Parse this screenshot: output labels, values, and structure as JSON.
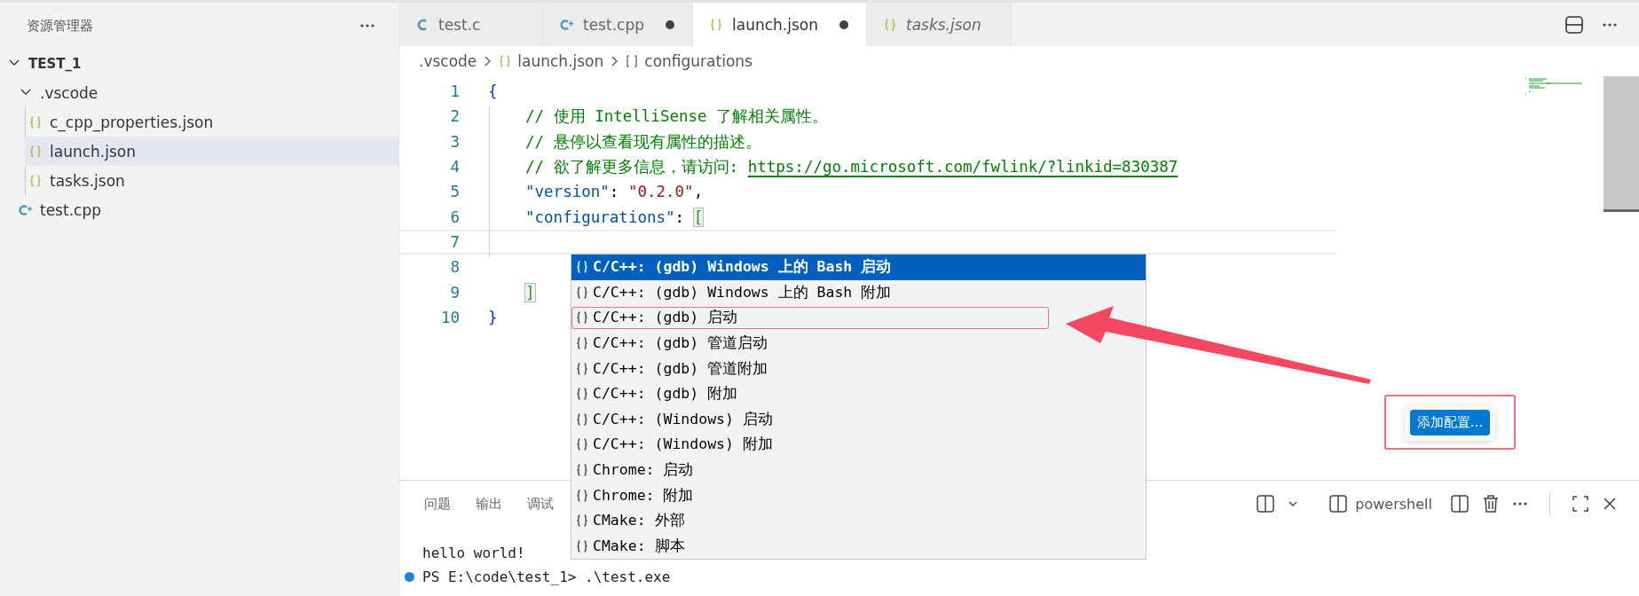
{
  "sidebar": {
    "title": "资源管理器",
    "tree": [
      {
        "label": "TEST_1",
        "kind": "root",
        "expanded": true,
        "selected": false,
        "children": [
          {
            "label": ".vscode",
            "kind": "folder",
            "expanded": true,
            "selected": false,
            "children": [
              {
                "label": "c_cpp_properties.json",
                "kind": "json",
                "selected": false
              },
              {
                "label": "launch.json",
                "kind": "json",
                "selected": true
              },
              {
                "label": "tasks.json",
                "kind": "json",
                "selected": false
              }
            ]
          },
          {
            "label": "test.cpp",
            "kind": "cpp",
            "selected": false
          }
        ]
      }
    ]
  },
  "tabs": [
    {
      "label": "test.c",
      "kind": "c",
      "selected": false,
      "modified": false,
      "preview": false
    },
    {
      "label": "test.cpp",
      "kind": "cpp",
      "selected": false,
      "modified": true,
      "preview": false
    },
    {
      "label": "launch.json",
      "kind": "json",
      "selected": true,
      "modified": true,
      "preview": false
    },
    {
      "label": "tasks.json",
      "kind": "json",
      "selected": false,
      "modified": false,
      "preview": true
    }
  ],
  "breadcrumb": [
    {
      "label": ".vscode",
      "kind": "folder"
    },
    {
      "label": "launch.json",
      "kind": "json"
    },
    {
      "label": "configurations",
      "kind": "array"
    }
  ],
  "editor": {
    "lines": [
      {
        "number": "1",
        "current": false,
        "indented": false,
        "tokens": [
          {
            "text": "{",
            "kind": "brace"
          }
        ]
      },
      {
        "number": "2",
        "current": false,
        "indented": true,
        "tokens": [
          {
            "text": "// 使用 IntelliSense 了解相关属性。",
            "kind": "comment"
          }
        ]
      },
      {
        "number": "3",
        "current": false,
        "indented": true,
        "tokens": [
          {
            "text": "// 悬停以查看现有属性的描述。",
            "kind": "comment"
          }
        ]
      },
      {
        "number": "4",
        "current": false,
        "indented": true,
        "tokens": [
          {
            "text": "// 欲了解更多信息，请访问: ",
            "kind": "comment"
          },
          {
            "text": "https://go.microsoft.com/fwlink/?linkid=830387",
            "kind": "link"
          }
        ]
      },
      {
        "number": "5",
        "current": false,
        "indented": true,
        "tokens": [
          {
            "text": "\"version\"",
            "kind": "key"
          },
          {
            "text": ": ",
            "kind": "punct"
          },
          {
            "text": "\"0.2.0\"",
            "kind": "string"
          },
          {
            "text": ",",
            "kind": "punct"
          }
        ]
      },
      {
        "number": "6",
        "current": false,
        "indented": true,
        "tokens": [
          {
            "text": "\"configurations\"",
            "kind": "key"
          },
          {
            "text": ": ",
            "kind": "punct"
          },
          {
            "text": "[",
            "kind": "bracket-match"
          }
        ]
      },
      {
        "number": "7",
        "current": true
      },
      {
        "number": "8",
        "current": false
      },
      {
        "number": "9",
        "current": false,
        "indented": true,
        "tokens": [
          {
            "text": "]",
            "kind": "bracket-match"
          }
        ]
      },
      {
        "number": "10",
        "current": false,
        "indented": false,
        "tokens": [
          {
            "text": "}",
            "kind": "brace"
          }
        ]
      }
    ]
  },
  "suggestions": [
    {
      "label": "C/C++: (gdb) Windows 上的 Bash 启动",
      "selected": true,
      "annotated": false
    },
    {
      "label": "C/C++: (gdb) Windows 上的 Bash 附加",
      "selected": false,
      "annotated": false
    },
    {
      "label": "C/C++: (gdb) 启动",
      "selected": false,
      "annotated": true
    },
    {
      "label": "C/C++: (gdb) 管道启动",
      "selected": false,
      "annotated": false
    },
    {
      "label": "C/C++: (gdb) 管道附加",
      "selected": false,
      "annotated": false
    },
    {
      "label": "C/C++: (gdb) 附加",
      "selected": false,
      "annotated": false
    },
    {
      "label": "C/C++: (Windows) 启动",
      "selected": false,
      "annotated": false
    },
    {
      "label": "C/C++: (Windows) 附加",
      "selected": false,
      "annotated": false
    },
    {
      "label": "Chrome: 启动",
      "selected": false,
      "annotated": false
    },
    {
      "label": "Chrome: 附加",
      "selected": false,
      "annotated": false
    },
    {
      "label": "CMake: 外部",
      "selected": false,
      "annotated": false
    },
    {
      "label": "CMake: 脚本",
      "selected": false,
      "annotated": false
    }
  ],
  "add_config_button": {
    "label": "添加配置...",
    "annotated": true
  },
  "panel": {
    "tabs": [
      {
        "label": "问题",
        "selected": false
      },
      {
        "label": "输出",
        "selected": false
      },
      {
        "label": "调试",
        "selected": false
      }
    ],
    "terminal_profile": "powershell",
    "terminal": [
      {
        "text": "hello world!",
        "prompt": false
      },
      {
        "text": "PS E:\\code\\test_1> .\\test.exe",
        "prompt": true
      }
    ]
  }
}
